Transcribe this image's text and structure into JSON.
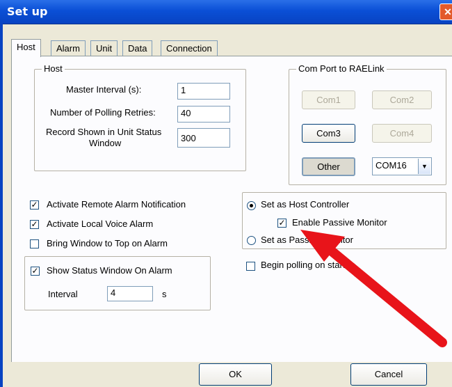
{
  "window": {
    "title": "Set up",
    "close_glyph": "✕"
  },
  "tabs": [
    {
      "label": "Host",
      "active": true
    },
    {
      "label": "Alarm"
    },
    {
      "label": "Unit"
    },
    {
      "label": "Data"
    },
    {
      "label": "Connection"
    }
  ],
  "host_group": {
    "legend": "Host",
    "master_interval_label": "Master Interval (s):",
    "master_interval_value": "1",
    "polling_retries_label": "Number of Polling Retries:",
    "polling_retries_value": "40",
    "record_shown_label_line1": "Record Shown in Unit Status",
    "record_shown_label_line2": "Window",
    "record_shown_value": "300"
  },
  "com_group": {
    "legend": "Com Port to RAELink",
    "com1": "Com1",
    "com2": "Com2",
    "com3": "Com3",
    "com4": "Com4",
    "other": "Other",
    "port_select": "COM16"
  },
  "options": {
    "remote_alarm": {
      "label": "Activate Remote Alarm Notification",
      "checked": true
    },
    "local_voice": {
      "label": "Activate Local Voice Alarm",
      "checked": true
    },
    "bring_to_top": {
      "label": "Bring Window to Top on Alarm",
      "checked": false
    },
    "show_status": {
      "label": "Show Status Window On Alarm",
      "checked": true
    },
    "interval_label": "Interval",
    "interval_value": "4",
    "interval_unit": "s"
  },
  "controller": {
    "host_controller": {
      "label": "Set as Host Controller",
      "selected": true
    },
    "passive_monitor_enable": {
      "label": "Enable Passive Monitor",
      "checked": true
    },
    "passive_monitor": {
      "label": "Set as Passive Monitor",
      "selected": false
    },
    "begin_polling": {
      "label": "Begin polling on startup",
      "checked": false
    }
  },
  "buttons": {
    "ok": "OK",
    "cancel": "Cancel"
  },
  "colors": {
    "annotation_arrow": "#e8141a",
    "title_bar": "#0a4fd6"
  }
}
